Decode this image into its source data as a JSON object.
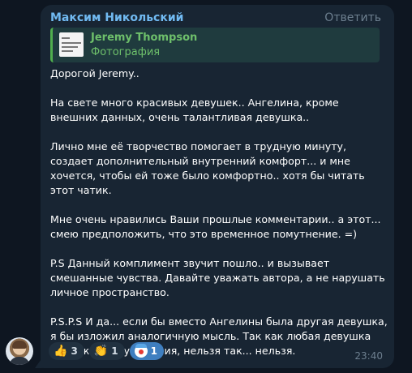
{
  "message": {
    "sender": "Максим Никольский",
    "reply_label": "Ответить",
    "quote": {
      "name": "Jeremy Thompson",
      "type": "Фотография"
    },
    "paragraphs": [
      "Дорогой Jeremy..",
      "На свете много красивых девушек.. Ангелина, кроме внешних данных, очень талантливая девушка..",
      "Лично мне её творчество помогает в трудную минуту, создает дополнительный внутренний комфорт... и мне хочется, чтобы ей тоже было комфортно.. хотя бы читать этот чатик.",
      "Мне очень нравились Ваши прошлые комментарии.. а этот... смею предположить, что это временное помутнение. =)",
      "P.S Данный комплимент звучит пошло.. и вызывает смешанные чувства. Давайте уважать автора, а не нарушать личное пространство.",
      "P.S.P.S И да... если бы вместо Ангелины была другая девушка, я бы изложил аналогичную мысль. Так как любая девушка заслуживает уважения, нельзя так... нельзя."
    ],
    "reactions": [
      {
        "emoji": "👍",
        "icon": "thumbs-up-icon",
        "count": "3"
      },
      {
        "emoji": "👏",
        "icon": "clapping-hands-icon",
        "count": "1"
      },
      {
        "emoji": "",
        "icon": "clown-face-icon",
        "count": "1"
      }
    ],
    "time": "23:40"
  },
  "colors": {
    "background": "#0e1621",
    "bubble": "#182533",
    "sender": "#71baf2",
    "quote_accent": "#4fae4e",
    "active_reaction": "#3f7fc0"
  }
}
